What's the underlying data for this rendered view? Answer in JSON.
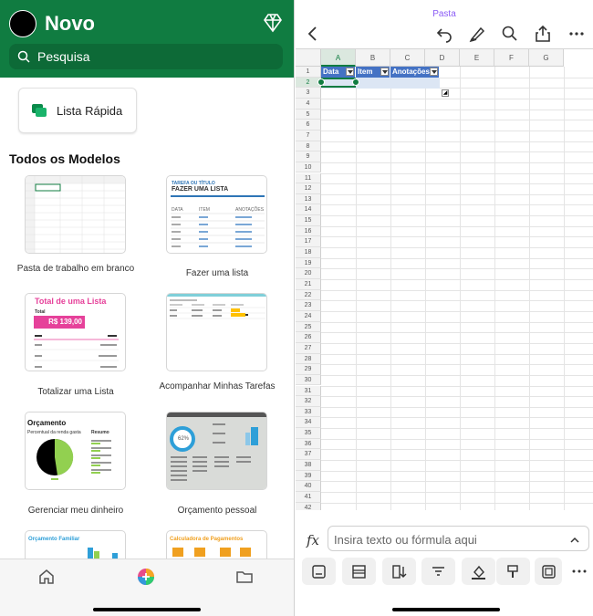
{
  "left": {
    "header": {
      "title": "Novo",
      "search_placeholder": "Pesquisa"
    },
    "quick_list": {
      "label": "Lista Rápida"
    },
    "section_title": "Todos os Modelos",
    "templates": [
      {
        "label": "Pasta de trabalho em branco"
      },
      {
        "label": "Fazer uma lista",
        "thumb_kicker": "TAREFA OU TÍTULO",
        "thumb_title": "FAZER UMA LISTA",
        "thumb_cols": [
          "DATA",
          "ITEM",
          "ANOTAÇÕES"
        ]
      },
      {
        "label": "Totalizar uma Lista",
        "thumb_title": "Total de uma Lista",
        "thumb_total_label": "Total",
        "thumb_total": "R$ 139,00"
      },
      {
        "label": "Acompanhar Minhas Tarefas"
      },
      {
        "label": "Gerenciar meu dinheiro",
        "thumb_title": "Orçamento",
        "thumb_sub1": "Percentual da renda gasta",
        "thumb_sub2": "Resumo"
      },
      {
        "label": "Orçamento pessoal",
        "thumb_pct": "62%"
      },
      {
        "label": "",
        "thumb_title": "Orçamento Familiar"
      },
      {
        "label": "",
        "thumb_title": "Calculadora de Pagamentos"
      }
    ]
  },
  "right": {
    "title": "Pasta",
    "columns": [
      "A",
      "B",
      "C",
      "D",
      "E",
      "F",
      "G"
    ],
    "table_headers": [
      "Data",
      "Item",
      "Anotações"
    ],
    "rows": [
      "1",
      "2",
      "3",
      "4",
      "5",
      "6",
      "7",
      "8",
      "9",
      "10",
      "11",
      "12",
      "13",
      "14",
      "15",
      "16",
      "17",
      "18",
      "19",
      "20",
      "21",
      "22",
      "23",
      "24",
      "25",
      "26",
      "27",
      "28",
      "29",
      "30",
      "31",
      "32",
      "33",
      "34",
      "35",
      "36",
      "37",
      "38",
      "39",
      "40",
      "41",
      "42"
    ],
    "formula_bar": {
      "fx": "fx",
      "placeholder": "Insira texto ou fórmula aqui"
    }
  },
  "colors": {
    "excel_green": "#107c41",
    "table_header_blue": "#4472c4",
    "accent_pink": "#e6419a"
  }
}
